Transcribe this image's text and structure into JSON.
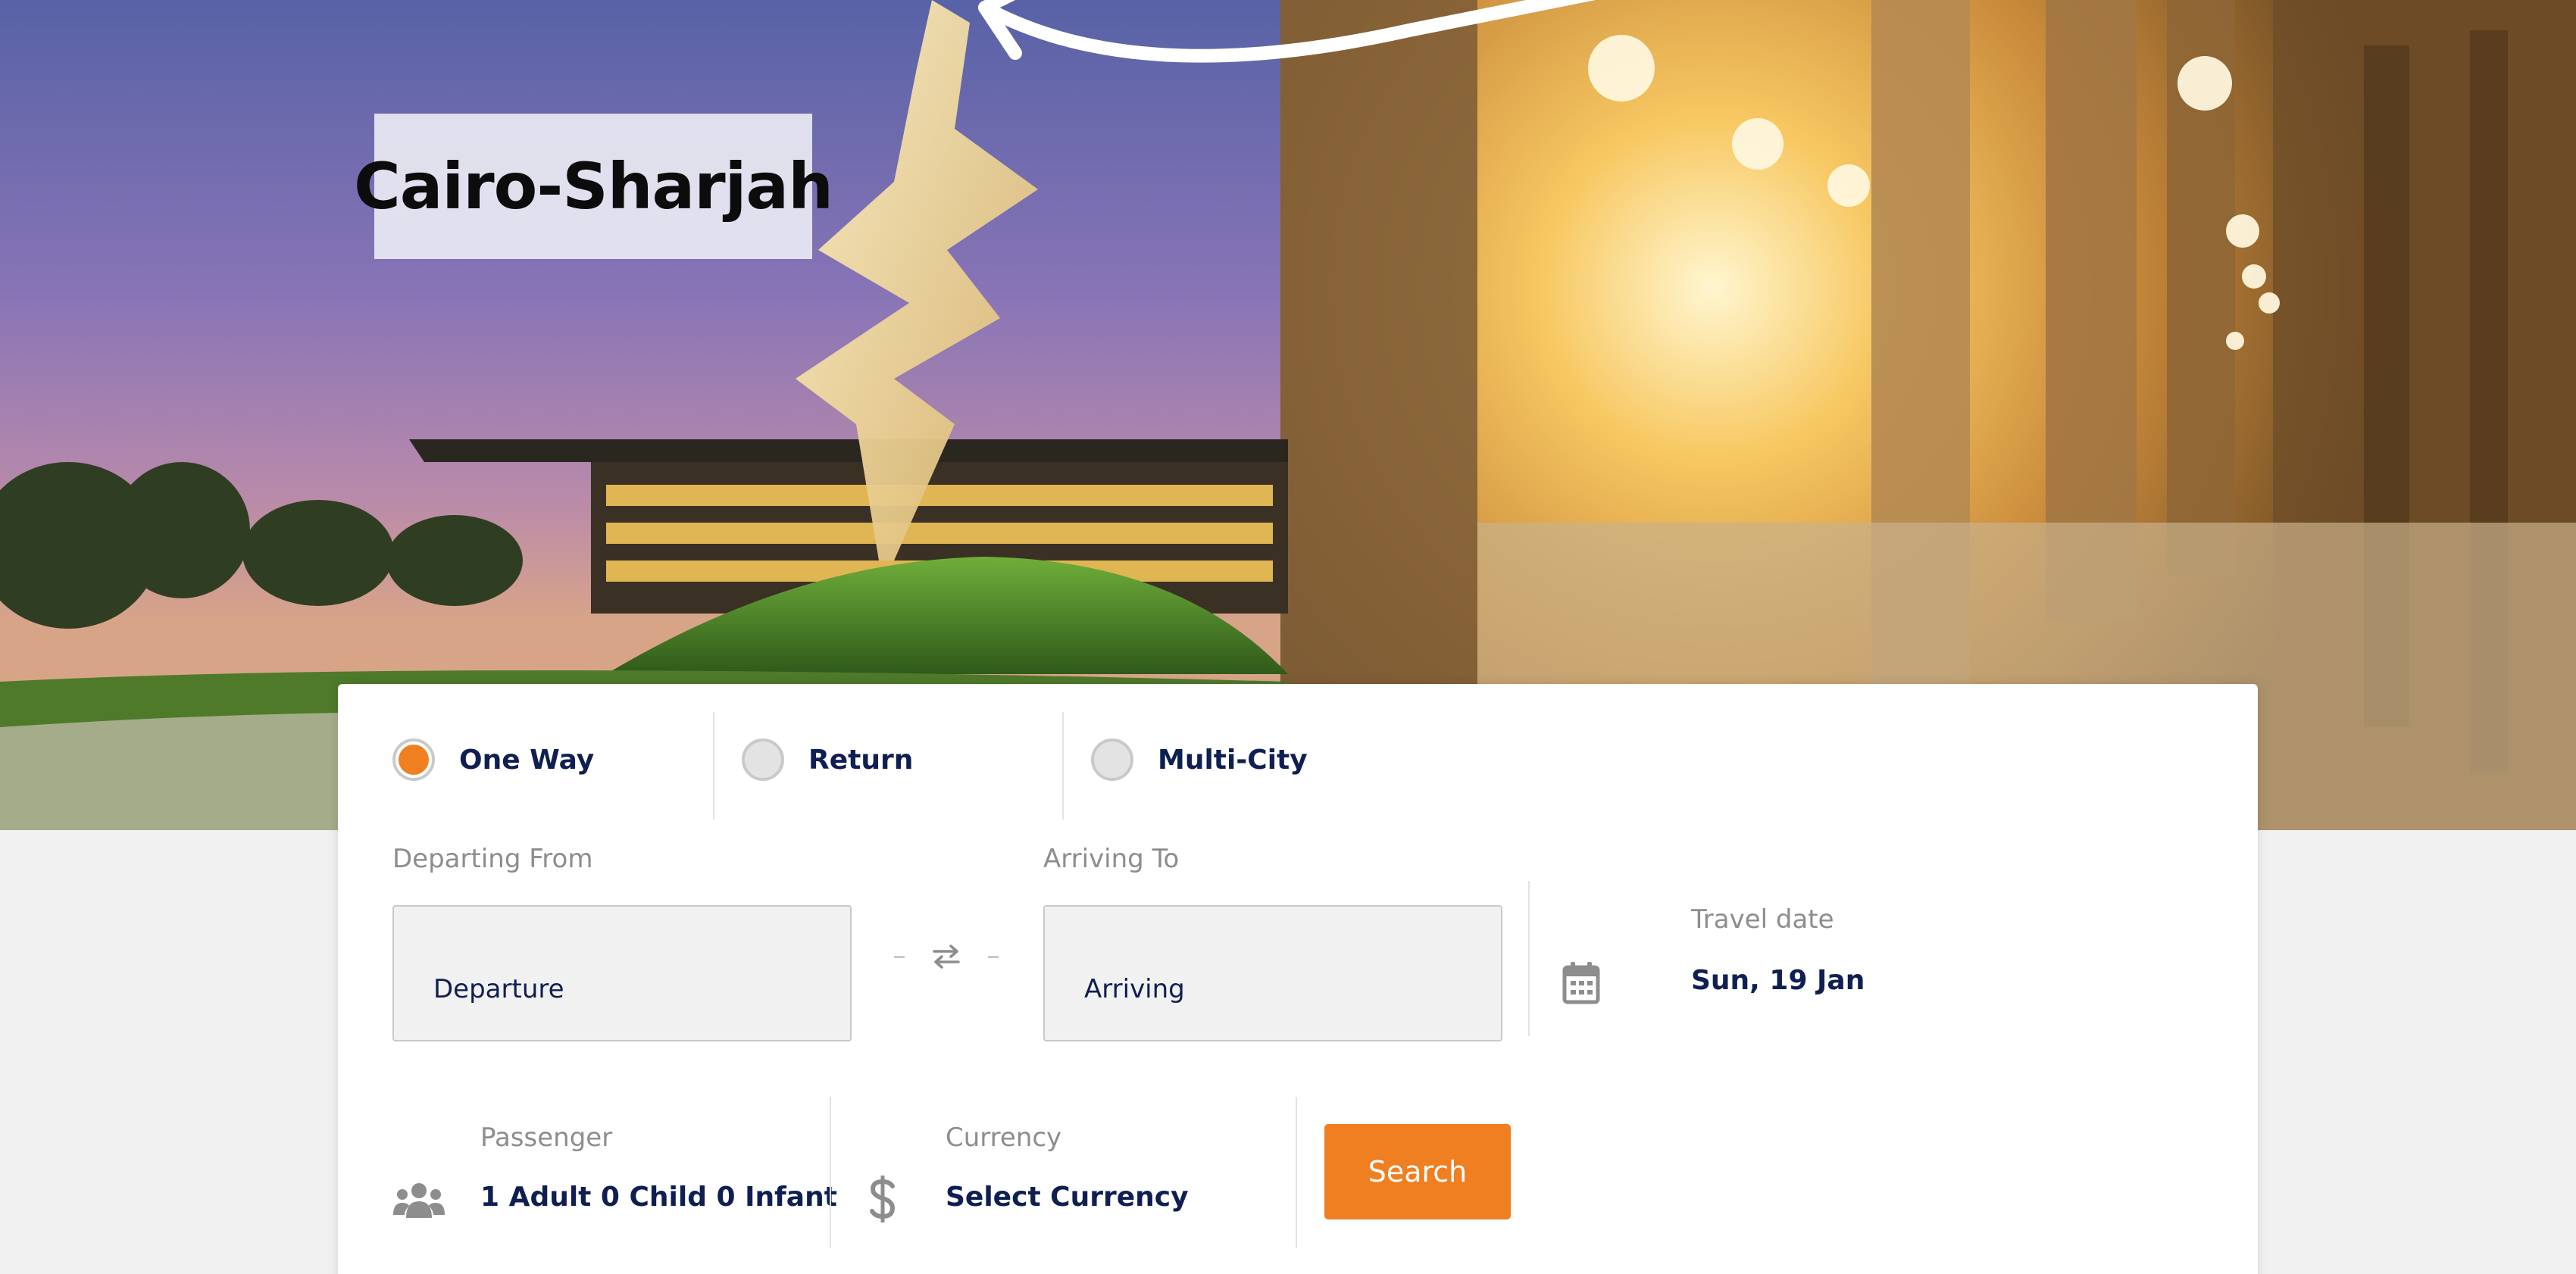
{
  "hero": {
    "route_title": "Cairo-Sharjah"
  },
  "trip_types": {
    "one_way": "One Way",
    "return": "Return",
    "multi_city": "Multi-City",
    "selected": "One Way"
  },
  "departing": {
    "label": "Departing From",
    "placeholder": "Departure",
    "value": ""
  },
  "arriving": {
    "label": "Arriving To",
    "placeholder": "Arriving",
    "value": ""
  },
  "travel_date": {
    "label": "Travel date",
    "value": "Sun, 19 Jan",
    "icon": "calendar-icon"
  },
  "passenger": {
    "label": "Passenger",
    "value": "1 Adult 0 Child 0 Infant",
    "icon": "users-icon"
  },
  "currency": {
    "label": "Currency",
    "value": "Select Currency",
    "icon": "dollar-icon"
  },
  "search": {
    "label": "Search"
  },
  "colors": {
    "accent": "#f07f22",
    "text_dark": "#0f1f52",
    "label_gray": "#8d8d8d"
  }
}
